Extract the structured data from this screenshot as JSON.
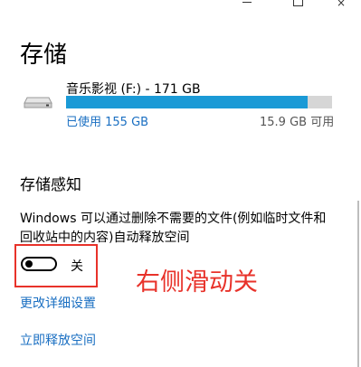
{
  "window": {
    "controls": {
      "minimize_icon": "minimize-icon",
      "maximize_icon": "maximize-icon",
      "close_glyph": "×"
    }
  },
  "page": {
    "title": "存储"
  },
  "drive": {
    "name": "音乐影视 (F:) - 171 GB",
    "used_label": "已使用 155 GB",
    "free_label": "15.9 GB 可用",
    "used_fraction": 0.907,
    "colors": {
      "fill": "#1b9ad6",
      "track": "#d6d6d6"
    }
  },
  "storage_sense": {
    "title": "存储感知",
    "description": "Windows 可以通过删除不需要的文件(例如临时文件和回收站中的内容)自动释放空间",
    "toggle": {
      "state": "off",
      "label": "关"
    },
    "annotation": "右侧滑动关",
    "links": {
      "change_settings": "更改详细设置",
      "free_up_now": "立即释放空间"
    }
  },
  "colors": {
    "link": "#1a6fc2",
    "annotation": "#e8322a"
  }
}
